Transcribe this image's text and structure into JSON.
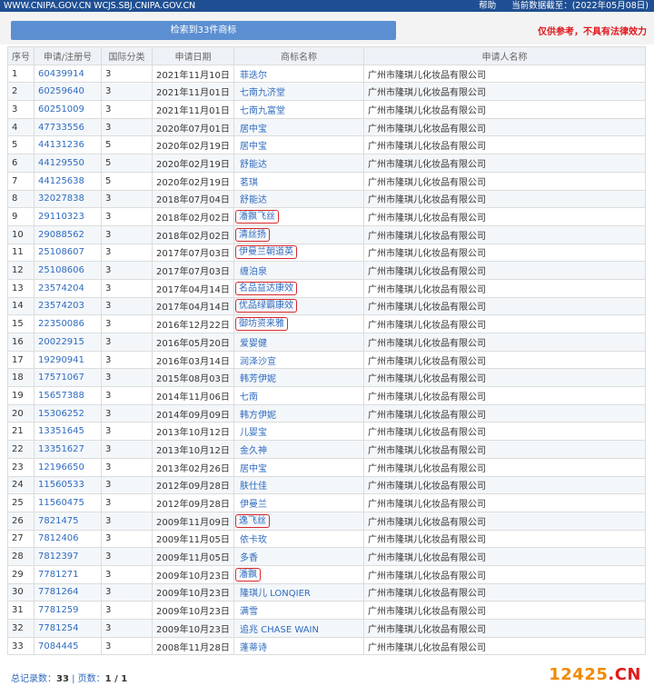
{
  "header": {
    "site": "WWW.CNIPA.GOV.CN  WCJS.SBJ.CNIPA.GOV.CN",
    "help": "帮助",
    "data_date": "当前数据截至：(2022年05月08日)"
  },
  "search": {
    "result_button": "检索到33件商标",
    "disclaimer": "仅供参考，不具有法律效力"
  },
  "table": {
    "columns": [
      "序号",
      "申请/注册号",
      "国际分类",
      "申请日期",
      "商标名称",
      "申请人名称"
    ],
    "rows": [
      {
        "no": "1",
        "reg": "60439914",
        "cls": "3",
        "date": "2021年11月10日",
        "name": "菲迭尔",
        "applicant": "广州市隆琪儿化妆品有限公司",
        "marked": false
      },
      {
        "no": "2",
        "reg": "60259640",
        "cls": "3",
        "date": "2021年11月01日",
        "name": "七南九济堂",
        "applicant": "广州市隆琪儿化妆品有限公司",
        "marked": false
      },
      {
        "no": "3",
        "reg": "60251009",
        "cls": "3",
        "date": "2021年11月01日",
        "name": "七南九富堂",
        "applicant": "广州市隆琪儿化妆品有限公司",
        "marked": false
      },
      {
        "no": "4",
        "reg": "47733556",
        "cls": "3",
        "date": "2020年07月01日",
        "name": "居中宝",
        "applicant": "广州市隆琪儿化妆品有限公司",
        "marked": false
      },
      {
        "no": "5",
        "reg": "44131236",
        "cls": "5",
        "date": "2020年02月19日",
        "name": "居中宝",
        "applicant": "广州市隆琪儿化妆品有限公司",
        "marked": false
      },
      {
        "no": "6",
        "reg": "44129550",
        "cls": "5",
        "date": "2020年02月19日",
        "name": "舒能达",
        "applicant": "广州市隆琪儿化妆品有限公司",
        "marked": false
      },
      {
        "no": "7",
        "reg": "44125638",
        "cls": "5",
        "date": "2020年02月19日",
        "name": "茗琪",
        "applicant": "广州市隆琪儿化妆品有限公司",
        "marked": false
      },
      {
        "no": "8",
        "reg": "32027838",
        "cls": "3",
        "date": "2018年07月04日",
        "name": "舒能达",
        "applicant": "广州市隆琪儿化妆品有限公司",
        "marked": false
      },
      {
        "no": "9",
        "reg": "29110323",
        "cls": "3",
        "date": "2018年02月02日",
        "name": "潘飘飞丝",
        "applicant": "广州市隆琪儿化妆品有限公司",
        "marked": true
      },
      {
        "no": "10",
        "reg": "29088562",
        "cls": "3",
        "date": "2018年02月02日",
        "name": "清丝扬",
        "applicant": "广州市隆琪儿化妆品有限公司",
        "marked": true
      },
      {
        "no": "11",
        "reg": "25108607",
        "cls": "3",
        "date": "2017年07月03日",
        "name": "伊曼兰朝道英",
        "applicant": "广州市隆琪儿化妆品有限公司",
        "marked": true
      },
      {
        "no": "12",
        "reg": "25108606",
        "cls": "3",
        "date": "2017年07月03日",
        "name": "缠泊泉",
        "applicant": "广州市隆琪儿化妆品有限公司",
        "marked": false
      },
      {
        "no": "13",
        "reg": "23574204",
        "cls": "3",
        "date": "2017年04月14日",
        "name": "名品益达康效",
        "applicant": "广州市隆琪儿化妆品有限公司",
        "marked": true
      },
      {
        "no": "14",
        "reg": "23574203",
        "cls": "3",
        "date": "2017年04月14日",
        "name": "优品绿霸康效",
        "applicant": "广州市隆琪儿化妆品有限公司",
        "marked": true
      },
      {
        "no": "15",
        "reg": "22350086",
        "cls": "3",
        "date": "2016年12月22日",
        "name": "御坊资来雅",
        "applicant": "广州市隆琪儿化妆品有限公司",
        "marked": true
      },
      {
        "no": "16",
        "reg": "20022915",
        "cls": "3",
        "date": "2016年05月20日",
        "name": "爱婴健",
        "applicant": "广州市隆琪儿化妆品有限公司",
        "marked": false
      },
      {
        "no": "17",
        "reg": "19290941",
        "cls": "3",
        "date": "2016年03月14日",
        "name": "润泽沙宣",
        "applicant": "广州市隆琪儿化妆品有限公司",
        "marked": false
      },
      {
        "no": "18",
        "reg": "17571067",
        "cls": "3",
        "date": "2015年08月03日",
        "name": "韩芳伊妮",
        "applicant": "广州市隆琪儿化妆品有限公司",
        "marked": false
      },
      {
        "no": "19",
        "reg": "15657388",
        "cls": "3",
        "date": "2014年11月06日",
        "name": "七南",
        "applicant": "广州市隆琪儿化妆品有限公司",
        "marked": false
      },
      {
        "no": "20",
        "reg": "15306252",
        "cls": "3",
        "date": "2014年09月09日",
        "name": "韩方伊妮",
        "applicant": "广州市隆琪儿化妆品有限公司",
        "marked": false
      },
      {
        "no": "21",
        "reg": "13351645",
        "cls": "3",
        "date": "2013年10月12日",
        "name": "儿婴宝",
        "applicant": "广州市隆琪儿化妆品有限公司",
        "marked": false
      },
      {
        "no": "22",
        "reg": "13351627",
        "cls": "3",
        "date": "2013年10月12日",
        "name": "金久神",
        "applicant": "广州市隆琪儿化妆品有限公司",
        "marked": false
      },
      {
        "no": "23",
        "reg": "12196650",
        "cls": "3",
        "date": "2013年02月26日",
        "name": "居中宝",
        "applicant": "广州市隆琪儿化妆品有限公司",
        "marked": false
      },
      {
        "no": "24",
        "reg": "11560533",
        "cls": "3",
        "date": "2012年09月28日",
        "name": "肤仕佳",
        "applicant": "广州市隆琪儿化妆品有限公司",
        "marked": false
      },
      {
        "no": "25",
        "reg": "11560475",
        "cls": "3",
        "date": "2012年09月28日",
        "name": "伊曼兰",
        "applicant": "广州市隆琪儿化妆品有限公司",
        "marked": false
      },
      {
        "no": "26",
        "reg": "7821475",
        "cls": "3",
        "date": "2009年11月09日",
        "name": "逸飞丝",
        "applicant": "广州市隆琪儿化妆品有限公司",
        "marked": true
      },
      {
        "no": "27",
        "reg": "7812406",
        "cls": "3",
        "date": "2009年11月05日",
        "name": "依卡玫",
        "applicant": "广州市隆琪儿化妆品有限公司",
        "marked": false
      },
      {
        "no": "28",
        "reg": "7812397",
        "cls": "3",
        "date": "2009年11月05日",
        "name": "多香",
        "applicant": "广州市隆琪儿化妆品有限公司",
        "marked": false
      },
      {
        "no": "29",
        "reg": "7781271",
        "cls": "3",
        "date": "2009年10月23日",
        "name": "潘飘",
        "applicant": "广州市隆琪儿化妆品有限公司",
        "marked": true
      },
      {
        "no": "30",
        "reg": "7781264",
        "cls": "3",
        "date": "2009年10月23日",
        "name": "隆琪儿 LONQIER",
        "applicant": "广州市隆琪儿化妆品有限公司",
        "marked": false
      },
      {
        "no": "31",
        "reg": "7781259",
        "cls": "3",
        "date": "2009年10月23日",
        "name": "满雪",
        "applicant": "广州市隆琪儿化妆品有限公司",
        "marked": false
      },
      {
        "no": "32",
        "reg": "7781254",
        "cls": "3",
        "date": "2009年10月23日",
        "name": "追兆 CHASE WAIN",
        "applicant": "广州市隆琪儿化妆品有限公司",
        "marked": false
      },
      {
        "no": "33",
        "reg": "7084445",
        "cls": "3",
        "date": "2008年11月28日",
        "name": "蓬蒂诗",
        "applicant": "广州市隆琪儿化妆品有限公司",
        "marked": false
      }
    ]
  },
  "footer": {
    "total_label": "总记录数：",
    "total_value": "33",
    "sep": " | ",
    "pages_label": "页数：",
    "pages_value": "1 / 1"
  },
  "watermark": {
    "digits": "12425",
    "dot": ".",
    "suffix": "CN"
  },
  "colors": {
    "topbar": "#1f4f92",
    "button": "#5c8fd1",
    "link": "#2f6bbf",
    "disclaimer": "#e0161c",
    "highlight_border": "#d9292e"
  }
}
